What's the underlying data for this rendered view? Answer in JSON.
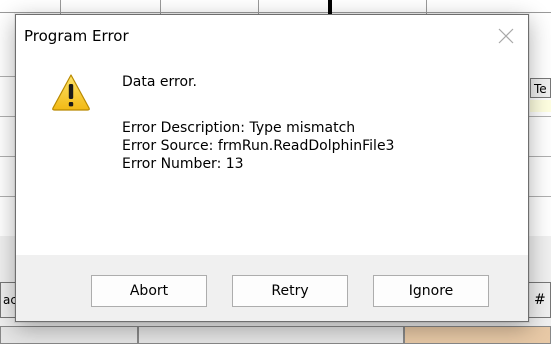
{
  "background": {
    "column_header_partial": "Te",
    "left_button_partial": "ac",
    "right_button_partial": "#"
  },
  "dialog": {
    "title": "Program Error",
    "close_icon": "close-icon",
    "icon": "warning-icon",
    "message_title": "Data error.",
    "description": "Error Description: Type mismatch",
    "source": "Error Source: frmRun.ReadDolphinFile3",
    "number": "Error Number: 13",
    "buttons": {
      "abort": "Abort",
      "retry": "Retry",
      "ignore": "Ignore"
    }
  },
  "colors": {
    "warning_yellow": "#f6c828",
    "footer_bg": "#f0f0f0",
    "accent_tab": "#e8c9a6"
  }
}
